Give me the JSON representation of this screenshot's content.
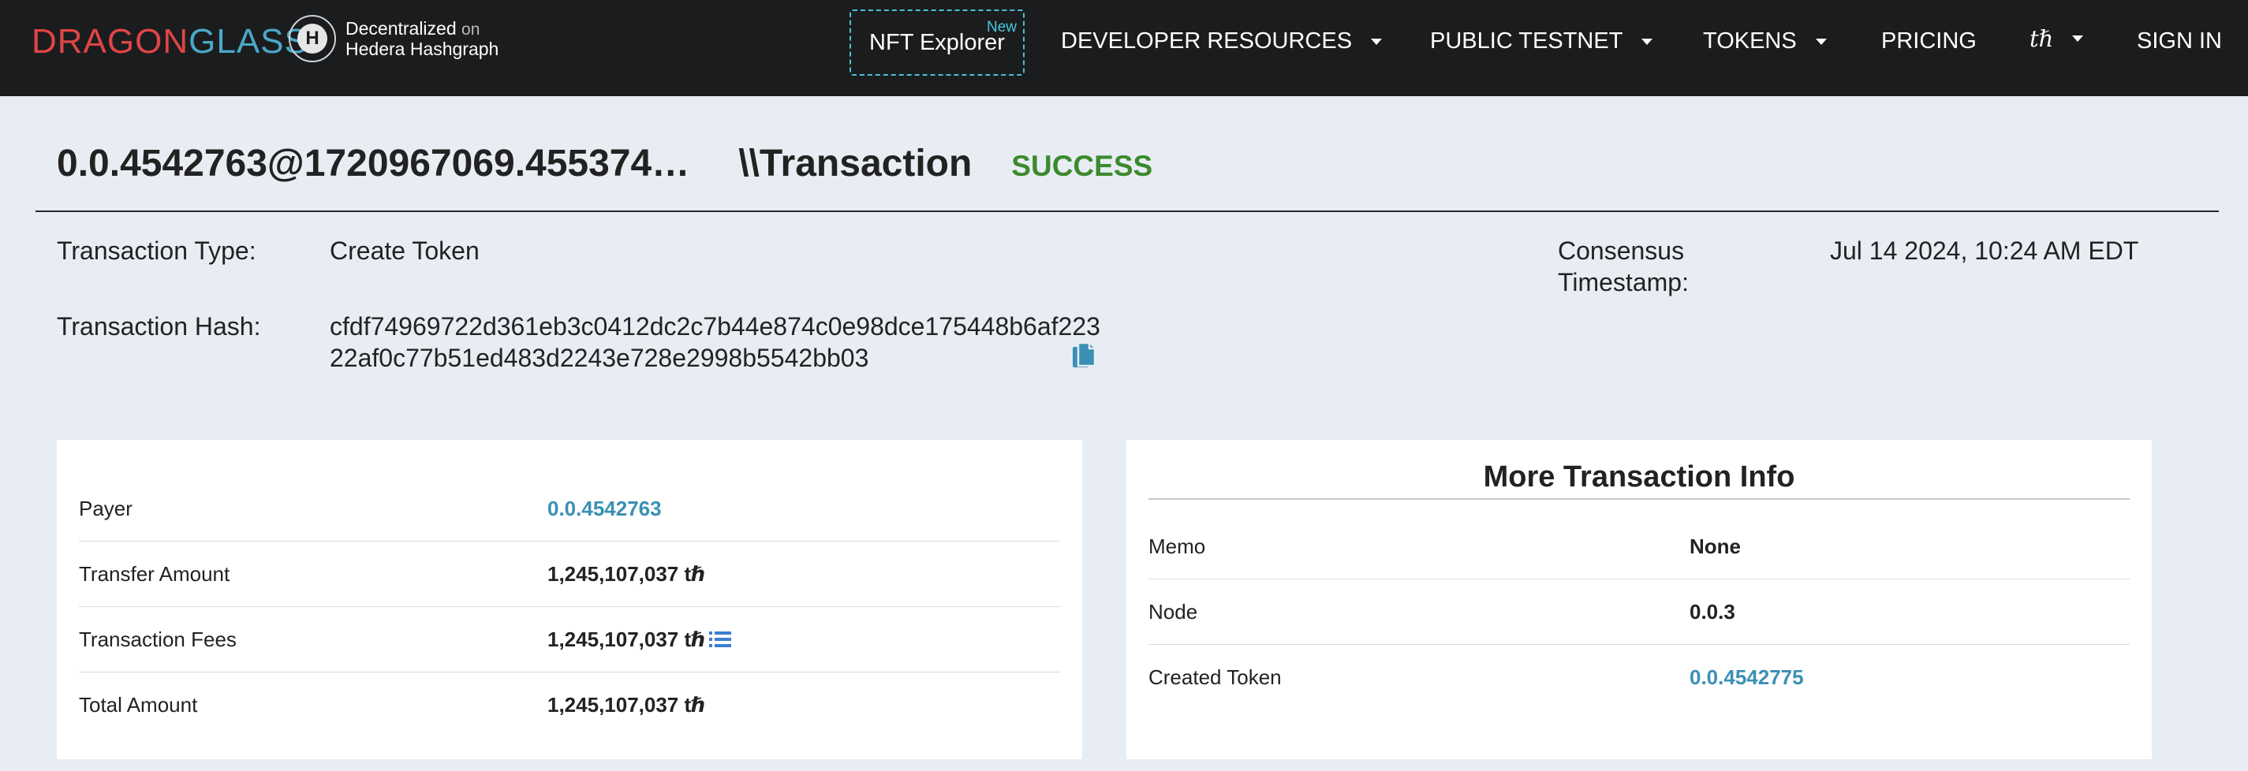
{
  "nav": {
    "logo_dragon": "DRAGON",
    "logo_glass": "GLASS",
    "hedera_mark": "H",
    "hedera_line1": "Decentralized",
    "hedera_on": "on",
    "hedera_line2": "Hedera Hashgraph",
    "nft_label": "NFT Explorer",
    "nft_badge": "New",
    "developer": "DEVELOPER RESOURCES",
    "testnet": "PUBLIC TESTNET",
    "tokens": "TOKENS",
    "pricing": "PRICING",
    "currency": "tℏ",
    "signin": "SIGN IN"
  },
  "header": {
    "id": "0.0.4542763@1720967069.455374…",
    "kind": "\\\\Transaction",
    "status": "SUCCESS"
  },
  "details": {
    "type_label": "Transaction Type:",
    "type_value": "Create Token",
    "hash_label": "Transaction Hash:",
    "hash_line1": "cfdf74969722d361eb3c0412dc2c7b44e874c0e98dce175448b6af223",
    "hash_line2": "22af0c77b51ed483d2243e728e2998b5542bb03",
    "consensus_label_1": "Consensus",
    "consensus_label_2": "Timestamp:",
    "consensus_value": "Jul 14 2024, 10:24 AM EDT"
  },
  "summary": [
    {
      "label": "Payer",
      "value": "0.0.4542763"
    },
    {
      "label": "Transfer Amount",
      "value": "1,245,107,037 tℏ"
    },
    {
      "label": "Transaction Fees",
      "value": "1,245,107,037 tℏ"
    },
    {
      "label": "Total Amount",
      "value": "1,245,107,037 tℏ"
    }
  ],
  "more_info": {
    "title": "More Transaction Info",
    "rows": [
      {
        "label": "Memo",
        "value": "None"
      },
      {
        "label": "Node",
        "value": "0.0.3"
      },
      {
        "label": "Created Token",
        "value": "0.0.4542775"
      }
    ]
  },
  "colors": {
    "nav_bg": "#1b1c1e",
    "page_bg": "#e8edf4",
    "link": "#3b8fb5",
    "success": "#3c8a2e",
    "brand_red": "#e04545",
    "brand_blue": "#4aa8c8"
  }
}
